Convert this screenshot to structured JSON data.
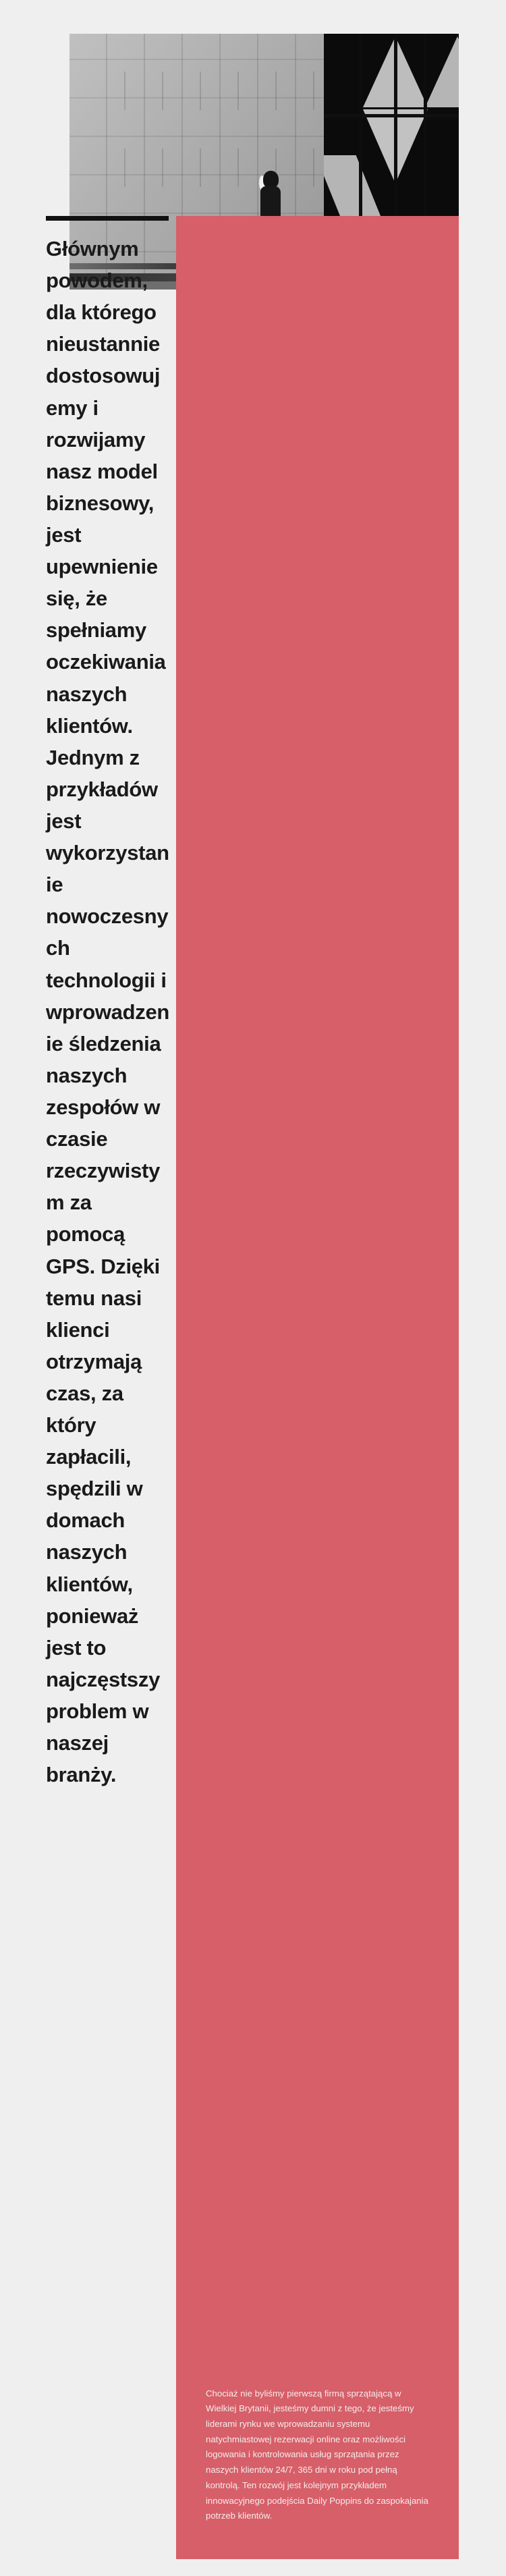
{
  "page": {
    "background_color": "#efefef",
    "accent_color": "#d65f69",
    "text_color": "#1a1a1a"
  },
  "hero": {
    "image_alt": "Czarno-biala fotografia: sylwetka osoby idacej wzdluz betonowej sciany obok ciemnej szklanej fasady budynku",
    "treatment": "black-and-white"
  },
  "divider": {
    "label": "",
    "color": "#111111"
  },
  "headline": {
    "text": "Głównym powodem, dla którego nieustannie dostosowujemy i rozwijamy nasz model biznesowy, jest upewnienie się, że spełniamy oczekiwania naszych klientów. Jednym z przykładów jest wykorzystanie nowoczesnych technologii i wprowadzenie śledzenia naszych zespołów w czasie rzeczywistym za pomocą GPS. Dzięki temu nasi klienci otrzymają czas, za który zapłacili, spędzili w domach naszych klientów, ponieważ jest to najczęstszy problem w naszej branży."
  },
  "panel": {
    "body": "Chociaż nie byliśmy pierwszą firmą sprzątającą w Wielkiej Brytanii, jesteśmy dumni z tego, że jesteśmy liderami rynku we wprowadzaniu systemu natychmiastowej rezerwacji online oraz możliwości logowania i kontrolowania usług sprzątania przez naszych klientów 24/7, 365 dni w roku pod pełną kontrolą. Ten rozwój jest kolejnym przykładem innowacyjnego podejścia Daily Poppins do zaspokajania potrzeb klientów.",
    "background_color": "#d65f69",
    "text_color": "#f6eceb"
  }
}
